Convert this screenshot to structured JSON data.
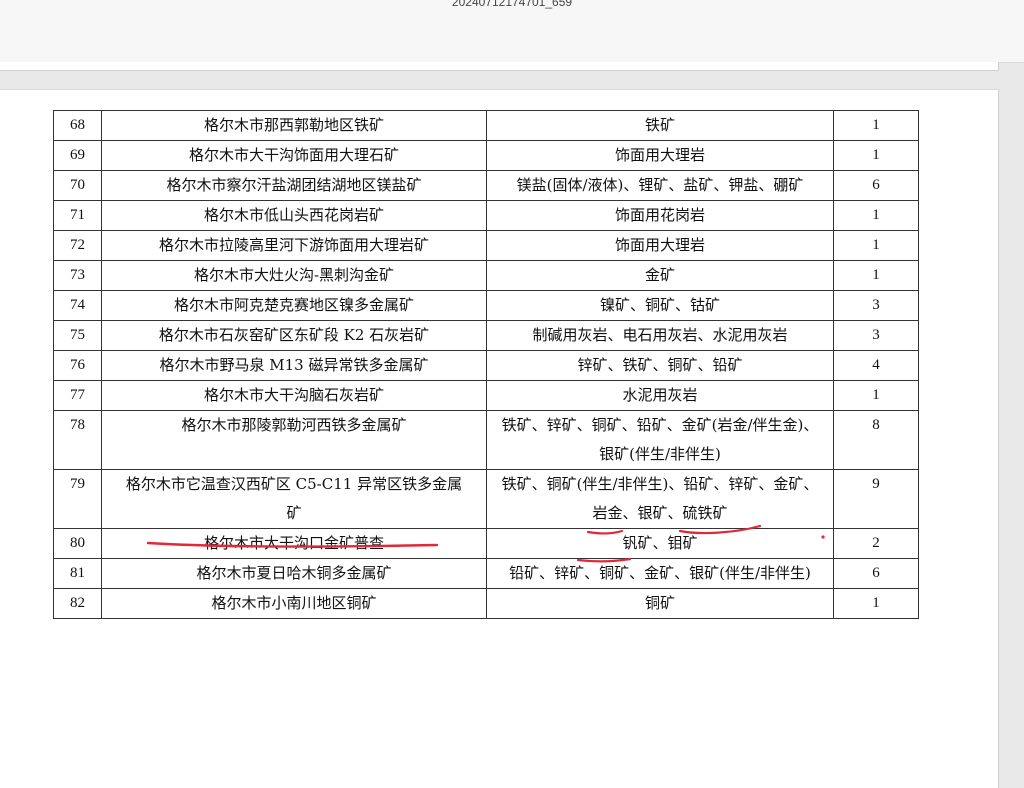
{
  "window": {
    "title": "20240712174701_659"
  },
  "table": {
    "rows": [
      {
        "no": "68",
        "name": "格尔木市那西郭勒地区铁矿",
        "minerals": "铁矿",
        "count": "1"
      },
      {
        "no": "69",
        "name": "格尔木市大干沟饰面用大理石矿",
        "minerals": "饰面用大理岩",
        "count": "1"
      },
      {
        "no": "70",
        "name": "格尔木市察尔汗盐湖团结湖地区镁盐矿",
        "minerals": "镁盐(固体/液体)、锂矿、盐矿、钾盐、硼矿",
        "count": "6"
      },
      {
        "no": "71",
        "name": "格尔木市低山头西花岗岩矿",
        "minerals": "饰面用花岗岩",
        "count": "1"
      },
      {
        "no": "72",
        "name": "格尔木市拉陵高里河下游饰面用大理岩矿",
        "minerals": "饰面用大理岩",
        "count": "1"
      },
      {
        "no": "73",
        "name": "格尔木市大灶火沟-黑刺沟金矿",
        "minerals": "金矿",
        "count": "1"
      },
      {
        "no": "74",
        "name": "格尔木市阿克楚克赛地区镍多金属矿",
        "minerals": "镍矿、铜矿、钴矿",
        "count": "3"
      },
      {
        "no": "75",
        "name": "格尔木市石灰窑矿区东矿段 K2 石灰岩矿",
        "minerals": "制碱用灰岩、电石用灰岩、水泥用灰岩",
        "count": "3"
      },
      {
        "no": "76",
        "name": "格尔木市野马泉 M13 磁异常铁多金属矿",
        "minerals": "锌矿、铁矿、铜矿、铅矿",
        "count": "4"
      },
      {
        "no": "77",
        "name": "格尔木市大干沟脑石灰岩矿",
        "minerals": "水泥用灰岩",
        "count": "1"
      },
      {
        "no": "78",
        "name": "格尔木市那陵郭勒河西铁多金属矿",
        "minerals_line1": "铁矿、锌矿、铜矿、铅矿、金矿(岩金/伴生金)、",
        "minerals_line2": "银矿(伴生/非伴生)",
        "count": "8"
      },
      {
        "no": "79",
        "name_line1": "格尔木市它温查汉西矿区 C5-C11 异常区铁多金属",
        "name_line2": "矿",
        "minerals_line1": "铁矿、铜矿(伴生/非伴生)、铅矿、锌矿、金矿、",
        "minerals_line2": "岩金、银矿、硫铁矿",
        "count": "9"
      },
      {
        "no": "80",
        "name": "格尔木市大干沟口金矿普查",
        "minerals": "钒矿、钼矿",
        "count": "2"
      },
      {
        "no": "81",
        "name": "格尔木市夏日哈木铜多金属矿",
        "minerals": "铅矿、锌矿、铜矿、金矿、银矿(伴生/非伴生)",
        "count": "6"
      },
      {
        "no": "82",
        "name": "格尔木市小南川地区铜矿",
        "minerals": "铜矿",
        "count": "1"
      }
    ]
  },
  "annotation": {
    "color": "#e0283a"
  }
}
